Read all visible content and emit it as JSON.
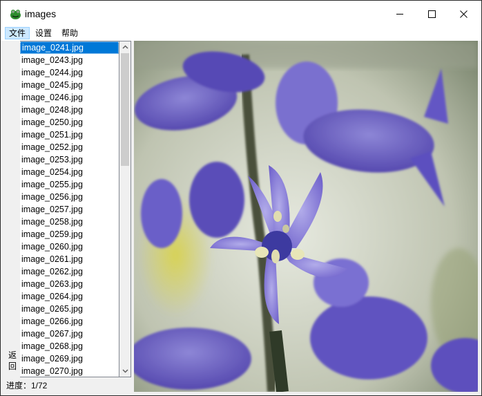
{
  "window": {
    "title": "images",
    "app_icon": "frog-app-icon"
  },
  "menu": {
    "items": [
      "文件",
      "设置",
      "帮助"
    ],
    "active_index": 0
  },
  "back_button": {
    "chars": [
      "返",
      "回"
    ]
  },
  "file_list": {
    "selected_index": 0,
    "items": [
      "image_0241.jpg",
      "image_0243.jpg",
      "image_0244.jpg",
      "image_0245.jpg",
      "image_0246.jpg",
      "image_0248.jpg",
      "image_0250.jpg",
      "image_0251.jpg",
      "image_0252.jpg",
      "image_0253.jpg",
      "image_0254.jpg",
      "image_0255.jpg",
      "image_0256.jpg",
      "image_0257.jpg",
      "image_0258.jpg",
      "image_0259.jpg",
      "image_0260.jpg",
      "image_0261.jpg",
      "image_0262.jpg",
      "image_0263.jpg",
      "image_0264.jpg",
      "image_0265.jpg",
      "image_0266.jpg",
      "image_0267.jpg",
      "image_0268.jpg",
      "image_0269.jpg",
      "image_0270.jpg"
    ]
  },
  "status": {
    "progress_text": "进度：1/72"
  },
  "colors": {
    "selection": "#0078d7",
    "flower": "#6c5fc4",
    "background": "#f0f0f0"
  }
}
